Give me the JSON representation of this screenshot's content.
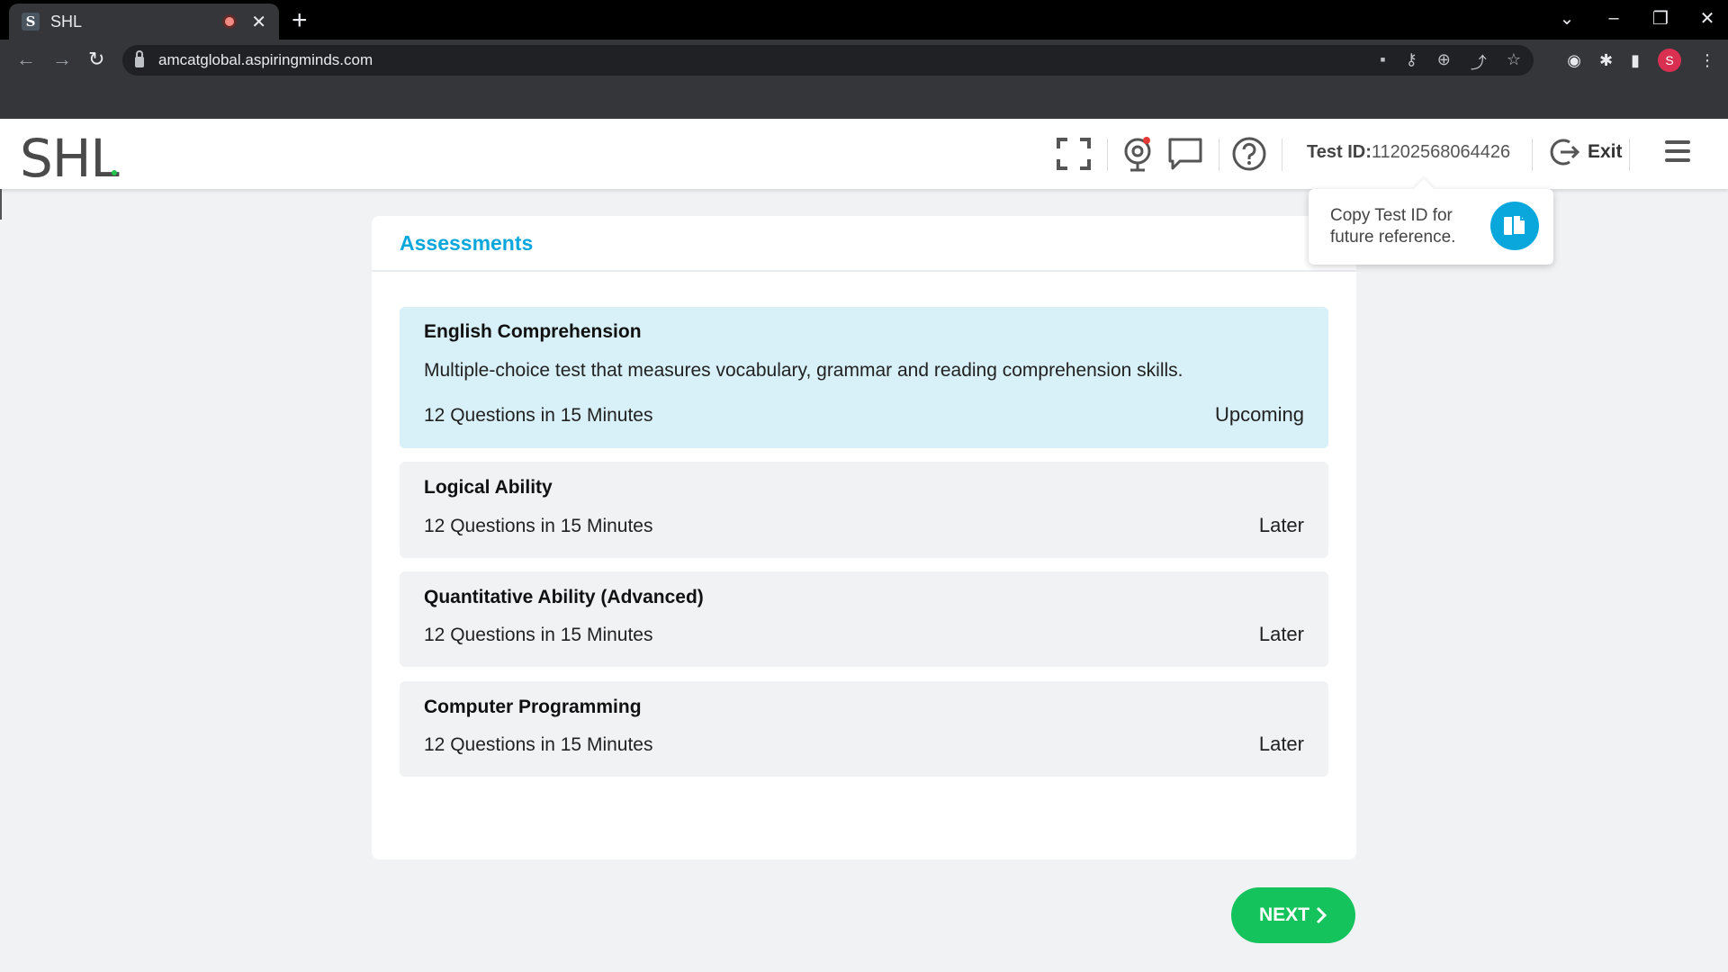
{
  "browser": {
    "tab_title": "SHL",
    "favicon_letter": "S",
    "url": "amcatglobal.aspiringminds.com",
    "profile_initial": "S"
  },
  "header": {
    "logo_text": "SHL",
    "test_id_label": "Test ID:",
    "test_id_value": "11202568064426",
    "exit_label": "Exit"
  },
  "tooltip": {
    "text": "Copy Test ID for future reference."
  },
  "assessments": {
    "title": "Assessments",
    "items": [
      {
        "title": "English Comprehension",
        "description": "Multiple-choice test that measures vocabulary, grammar and reading comprehension skills.",
        "meta": "12 Questions in 15 Minutes",
        "status": "Upcoming"
      },
      {
        "title": "Logical Ability",
        "meta": "12 Questions in 15 Minutes",
        "status": "Later"
      },
      {
        "title": "Quantitative Ability (Advanced)",
        "meta": "12 Questions in 15 Minutes",
        "status": "Later"
      },
      {
        "title": "Computer Programming",
        "meta": "12 Questions in 15 Minutes",
        "status": "Later"
      }
    ]
  },
  "footer": {
    "next_label": "NEXT"
  },
  "colors": {
    "accent": "#0aa7dc",
    "next_button": "#14c35b",
    "active_item": "#d8f0f8",
    "brand_dot": "#21c34d"
  }
}
